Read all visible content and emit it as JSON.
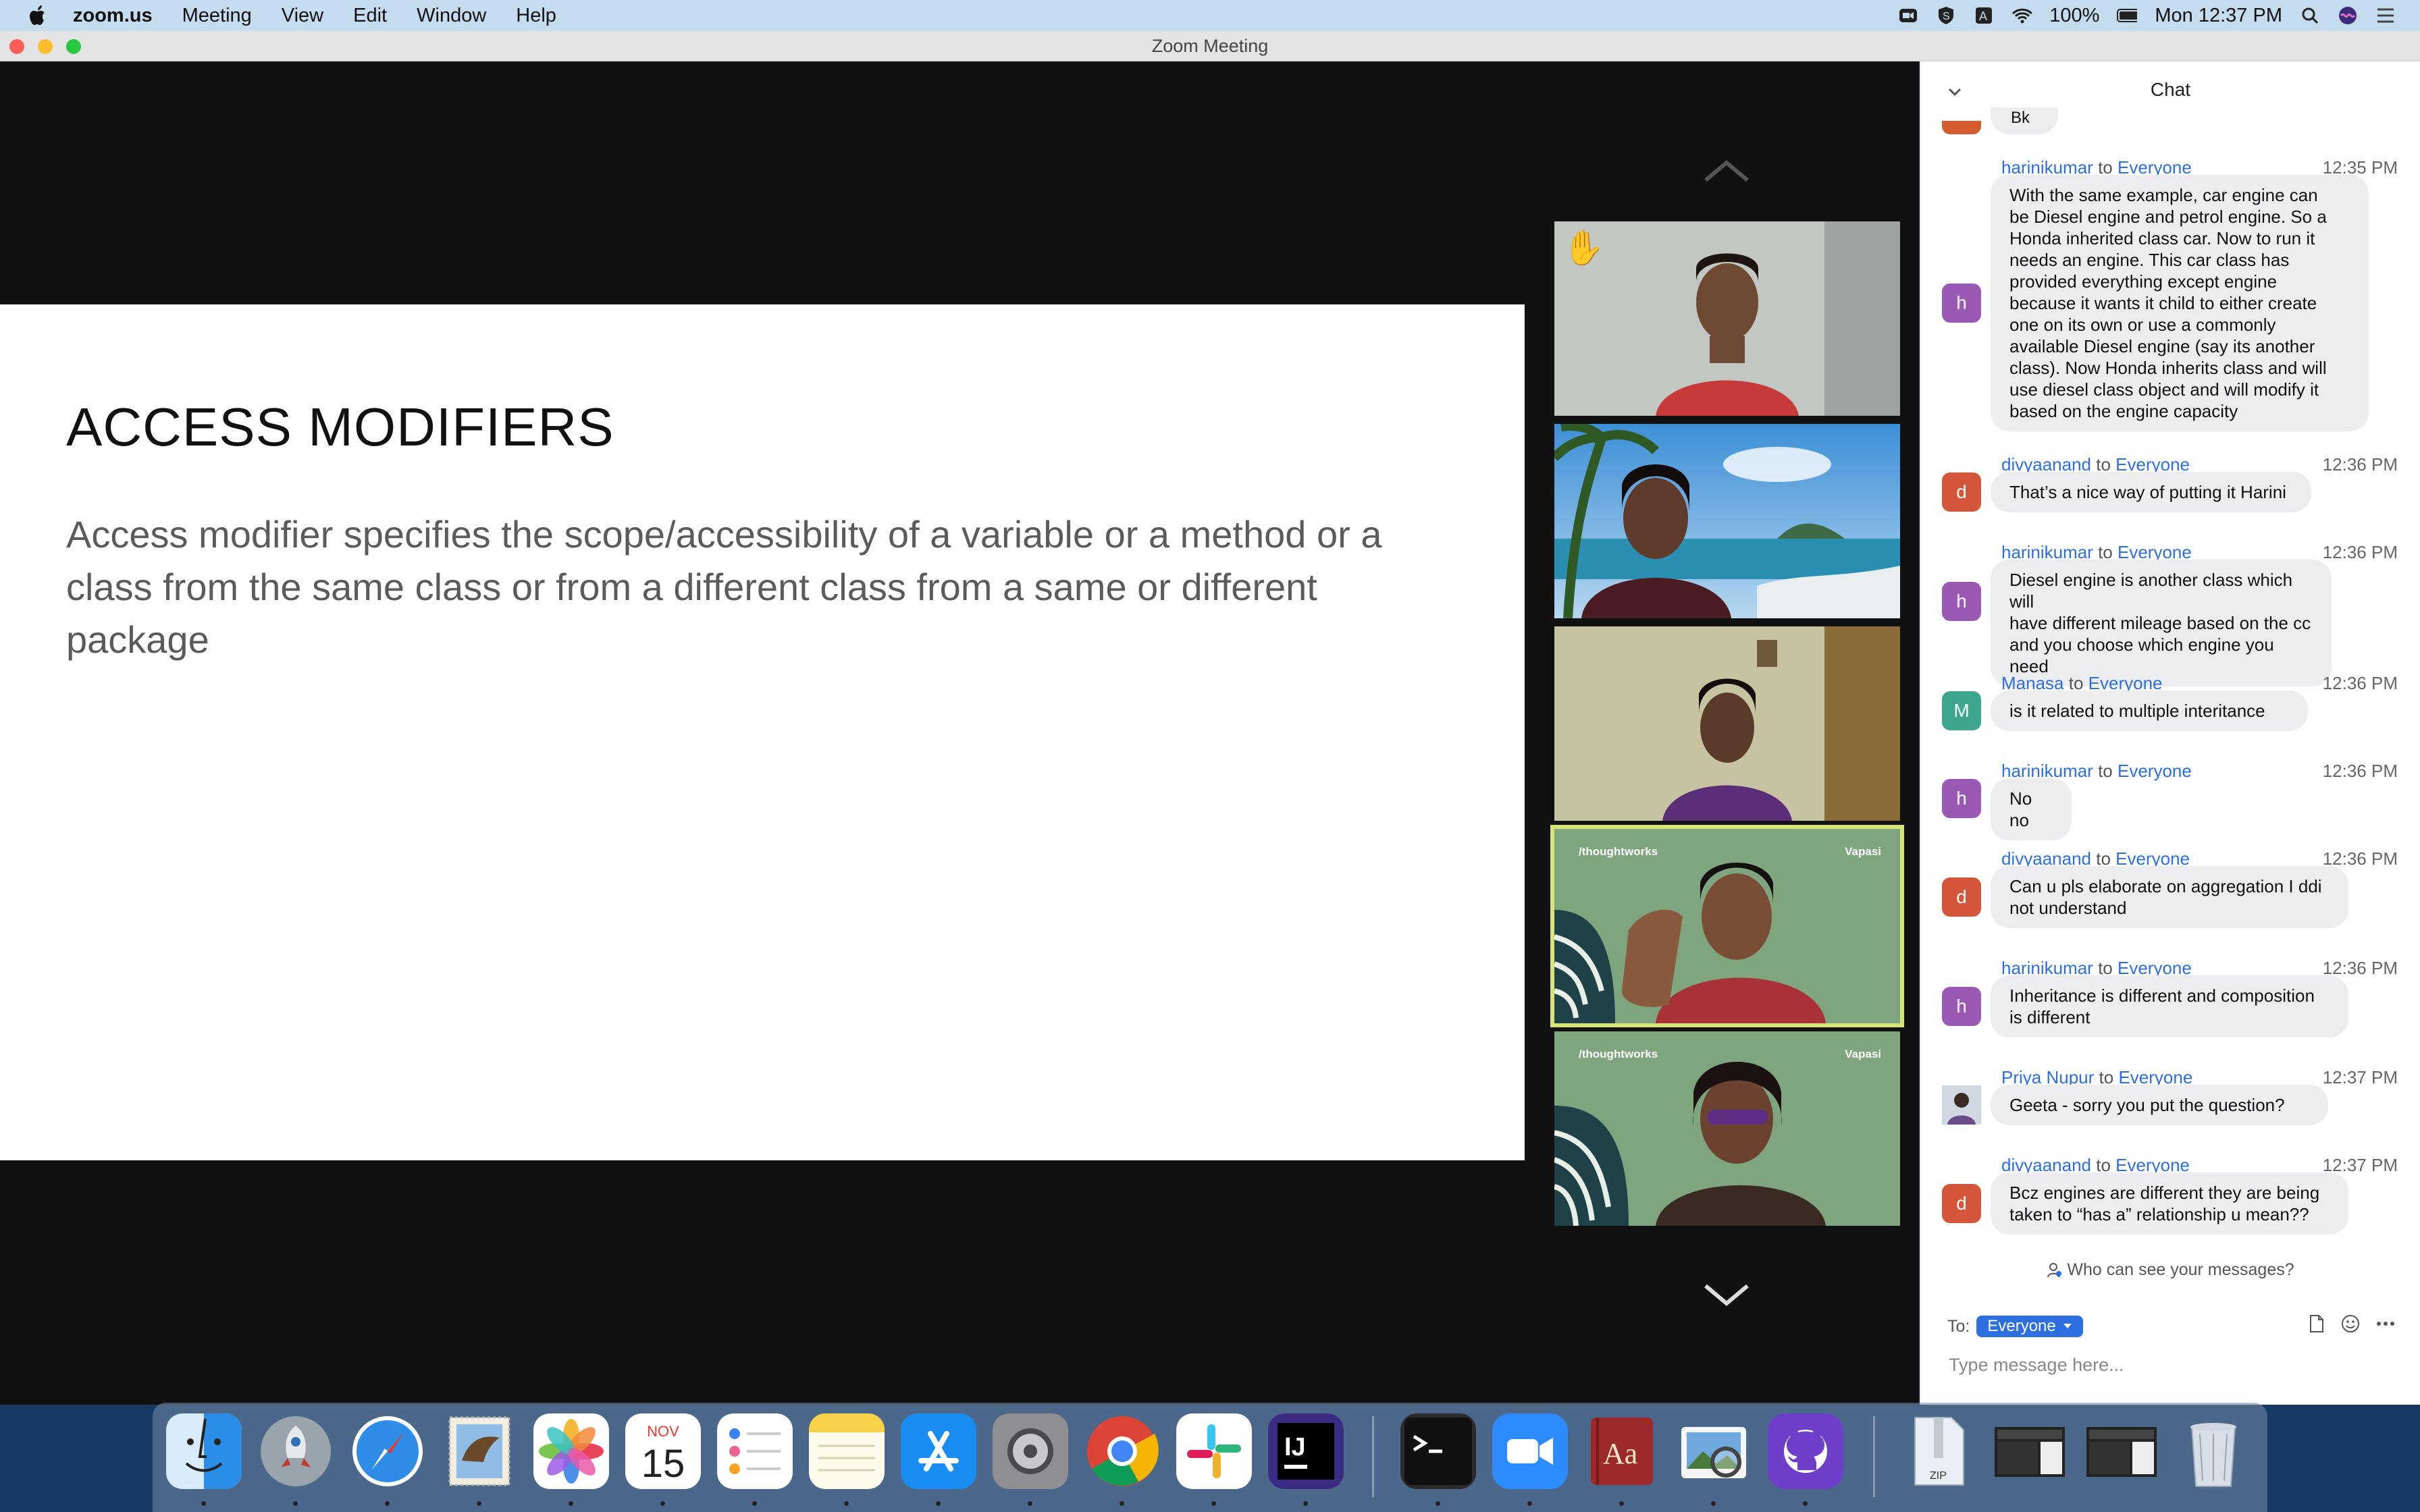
{
  "menubar": {
    "app_name": "zoom.us",
    "menus": [
      "Meeting",
      "View",
      "Edit",
      "Window",
      "Help"
    ],
    "battery": "100%",
    "clock": "Mon 12:37 PM"
  },
  "window": {
    "title": "Zoom Meeting"
  },
  "slide": {
    "title": "ACCESS MODIFIERS",
    "body": "Access modifier specifies the scope/accessibility of a variable or a method or a class from the same class or from a different class from a same or different package"
  },
  "gallery": {
    "tile4_brand_left": "/thoughtworks",
    "tile4_brand_right": "Vapasi",
    "tile5_brand_left": "/thoughtworks",
    "tile5_brand_right": "Vapasi"
  },
  "chat": {
    "title": "Chat",
    "partial_text": "Bk",
    "messages": [
      {
        "sender": "harinikumar",
        "to": "to",
        "recipient": "Everyone",
        "time": "12:35 PM",
        "avatar": "h",
        "avatar_color": "#9b59b6",
        "lines": [
          "With the same example, car engine can",
          "be Diesel engine and petrol engine. So a",
          "Honda inherited class car. Now to run it",
          "needs an engine. This car class has",
          "provided everything except engine",
          "because it wants it child to either create",
          "one on its own or use a commonly",
          "available Diesel engine (say its another",
          "class). Now Honda inherits class and will",
          "use diesel class object and will modify it",
          "based on the engine capacity"
        ]
      },
      {
        "sender": "divyaanand",
        "to": "to",
        "recipient": "Everyone",
        "time": "12:36 PM",
        "avatar": "d",
        "avatar_color": "#d4563a",
        "lines": [
          "That’s a nice way of putting it Harini"
        ]
      },
      {
        "sender": "harinikumar",
        "to": "to",
        "recipient": "Everyone",
        "time": "12:36 PM",
        "avatar": "h",
        "avatar_color": "#9b59b6",
        "lines": [
          "Diesel engine is another class which will",
          "have different mileage based on the cc",
          "and you choose which engine you need"
        ]
      },
      {
        "sender": "Manasa",
        "to": "to",
        "recipient": "Everyone",
        "time": "12:36 PM",
        "avatar": "M",
        "avatar_color": "#3ea58f",
        "lines": [
          "is it related to multiple interitance"
        ]
      },
      {
        "sender": "harinikumar",
        "to": "to",
        "recipient": "Everyone",
        "time": "12:36 PM",
        "avatar": "h",
        "avatar_color": "#9b59b6",
        "lines": [
          "No no"
        ]
      },
      {
        "sender": "divyaanand",
        "to": "to",
        "recipient": "Everyone",
        "time": "12:36 PM",
        "avatar": "d",
        "avatar_color": "#d4563a",
        "lines": [
          "Can u pls elaborate on aggregation I ddi",
          "not understand"
        ]
      },
      {
        "sender": "harinikumar",
        "to": "to",
        "recipient": "Everyone",
        "time": "12:36 PM",
        "avatar": "h",
        "avatar_color": "#9b59b6",
        "lines": [
          "Inheritance is different and composition",
          "is different"
        ]
      },
      {
        "sender": "Priya Nupur",
        "to": "to",
        "recipient": "Everyone",
        "time": "12:37 PM",
        "avatar": "",
        "avatar_color": "#6a7f9a",
        "lines": [
          "Geeta - sorry you put the question?"
        ]
      },
      {
        "sender": "divyaanand",
        "to": "to",
        "recipient": "Everyone",
        "time": "12:37 PM",
        "avatar": "d",
        "avatar_color": "#d4563a",
        "lines": [
          "Bcz engines are different they are being",
          "taken to “has a” relationship u mean??"
        ]
      }
    ],
    "who_can_see": "Who can see your messages?",
    "to_label": "To:",
    "to_value": "Everyone",
    "input_placeholder": "Type message here..."
  },
  "dock": {
    "calendar_month": "NOV",
    "calendar_day": "15",
    "dictionary_label": "Aa",
    "archive_label": "ZIP",
    "apps": [
      "finder-icon",
      "launchpad-icon",
      "safari-icon",
      "mail-stamp-icon",
      "photos-icon",
      "calendar-icon",
      "reminders-icon",
      "notes-icon",
      "app-store-icon",
      "system-preferences-icon",
      "chrome-icon",
      "slack-icon",
      "intellij-icon",
      "terminal-icon",
      "zoom-icon",
      "dictionary-icon",
      "preview-icon",
      "github-desktop-icon",
      "archive-icon",
      "window-thumbnail-icon",
      "window-thumbnail-icon",
      "trash-icon"
    ]
  }
}
